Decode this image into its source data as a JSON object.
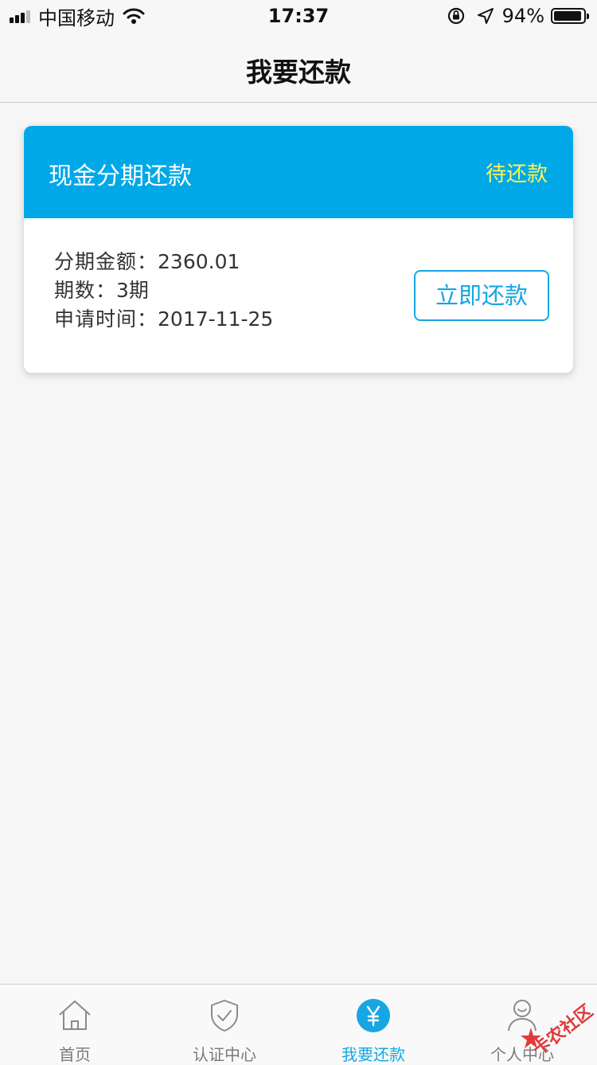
{
  "status_bar": {
    "carrier": "中国移动",
    "time": "17:37",
    "battery_percent": "94%",
    "battery_level": 0.94
  },
  "nav": {
    "title": "我要还款"
  },
  "loan_card": {
    "title": "现金分期还款",
    "status": "待还款",
    "amount_label": "分期金额：",
    "amount_value": "2360.01",
    "periods_label": "期数：",
    "periods_value": "3期",
    "date_label": "申请时间：",
    "date_value": "2017-11-25",
    "repay_button": "立即还款"
  },
  "tab_bar": {
    "tabs": [
      {
        "label": "首页",
        "icon": "home-icon",
        "active": false
      },
      {
        "label": "认证中心",
        "icon": "shield-check-icon",
        "active": false
      },
      {
        "label": "我要还款",
        "icon": "yen-icon",
        "active": true
      },
      {
        "label": "个人中心",
        "icon": "user-icon",
        "active": false
      }
    ]
  },
  "watermark": {
    "text": "卡农社区"
  },
  "colors": {
    "accent": "#00a8e8",
    "status_yellow": "#fff35c",
    "tab_active": "#16a6e3"
  }
}
